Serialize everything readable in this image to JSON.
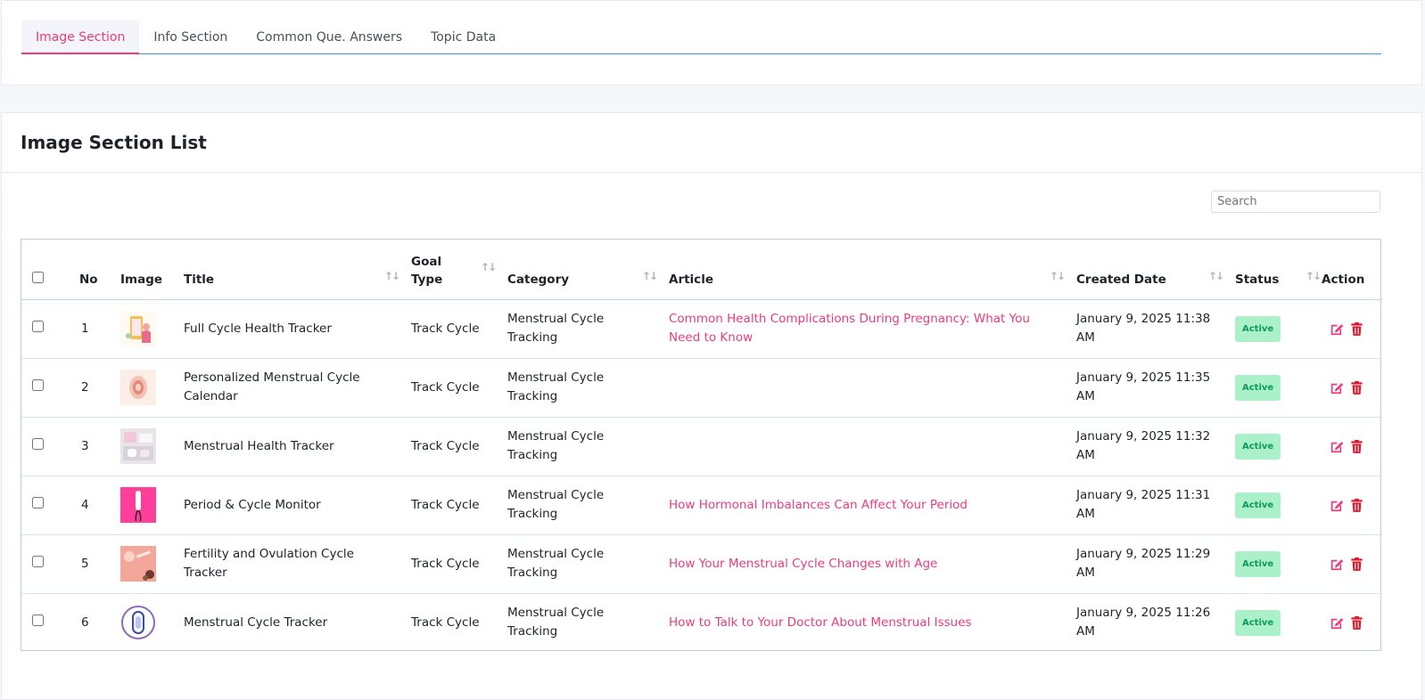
{
  "tabs": [
    "Image Section",
    "Info Section",
    "Common Que. Answers",
    "Topic Data"
  ],
  "active_tab": "Image Section",
  "list": {
    "title": "Image Section List",
    "search_placeholder": "Search",
    "columns": [
      "No",
      "Image",
      "Title",
      "Goal Type",
      "Category",
      "Article",
      "Created Date",
      "Status",
      "Action"
    ],
    "rows": [
      {
        "no": "1",
        "image": "phone-woman-illustration",
        "title": "Full Cycle Health Tracker",
        "goal_type": "Track Cycle",
        "category": "Menstrual Cycle Tracking",
        "article": "Common Health Complications During Pregnancy: What You Need to Know",
        "created": "January 9, 2025 11:38 AM",
        "status": "Active"
      },
      {
        "no": "2",
        "image": "pink-calendar-illustration",
        "title": "Personalized Menstrual Cycle Calendar",
        "goal_type": "Track Cycle",
        "category": "Menstrual Cycle Tracking",
        "article": "",
        "created": "January 9, 2025 11:35 AM",
        "status": "Active"
      },
      {
        "no": "3",
        "image": "pads-photo",
        "title": "Menstrual Health Tracker",
        "goal_type": "Track Cycle",
        "category": "Menstrual Cycle Tracking",
        "article": "",
        "created": "January 9, 2025 11:32 AM",
        "status": "Active"
      },
      {
        "no": "4",
        "image": "pink-tampon-photo",
        "title": "Period & Cycle Monitor",
        "goal_type": "Track Cycle",
        "category": "Menstrual Cycle Tracking",
        "article": "How Hormonal Imbalances Can Affect Your Period",
        "created": "January 9, 2025 11:31 AM",
        "status": "Active"
      },
      {
        "no": "5",
        "image": "pink-flatlay-photo",
        "title": "Fertility and Ovulation Cycle Tracker",
        "goal_type": "Track Cycle",
        "category": "Menstrual Cycle Tracking",
        "article": "How Your Menstrual Cycle Changes with Age",
        "created": "January 9, 2025 11:29 AM",
        "status": "Active"
      },
      {
        "no": "6",
        "image": "pad-circle-icon",
        "title": "Menstrual Cycle Tracker",
        "goal_type": "Track Cycle",
        "category": "Menstrual Cycle Tracking",
        "article": "How to Talk to Your Doctor About Menstrual Issues",
        "created": "January 9, 2025 11:26 AM",
        "status": "Active"
      }
    ]
  },
  "colors": {
    "accent": "#ec3c7e",
    "tab_underline": "#4c8df0",
    "badge_bg": "#aaf0c9",
    "badge_text": "#0c9b56",
    "delete": "#e0162b"
  }
}
